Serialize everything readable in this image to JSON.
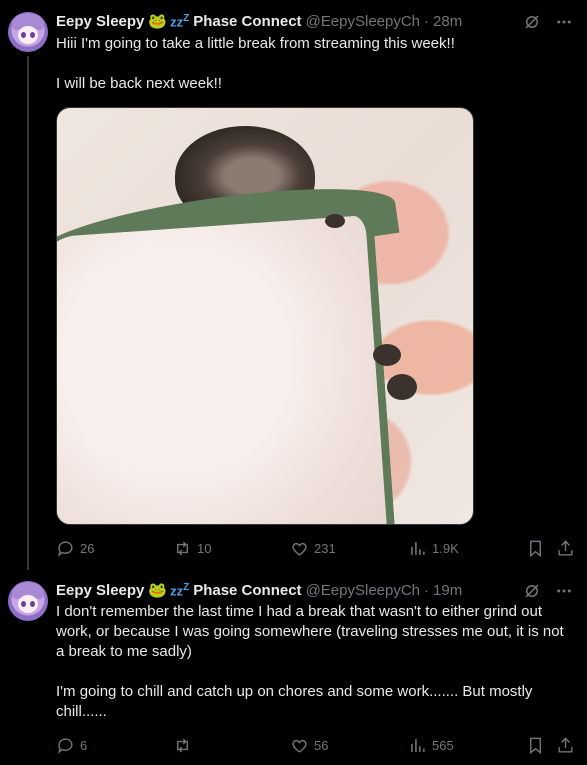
{
  "tweets": [
    {
      "author": {
        "name": "Eepy Sleepy",
        "emoji": "🐸",
        "zz": "zz",
        "zz_sup": "Z",
        "org": "Phase Connect",
        "handle": "@EepySleepyCh"
      },
      "time": "28m",
      "text": "Hiii I'm going to take a little break from streaming this week!!\n\nI will be back next week!!",
      "has_media": true,
      "stats": {
        "replies": "26",
        "reposts": "10",
        "likes": "231",
        "views": "1.9K"
      }
    },
    {
      "author": {
        "name": "Eepy Sleepy",
        "emoji": "🐸",
        "zz": "zz",
        "zz_sup": "Z",
        "org": "Phase Connect",
        "handle": "@EepySleepyCh"
      },
      "time": "19m",
      "text": "I don't remember the last time I had a break that wasn't to either grind out work, or because I was going somewhere (traveling stresses me out, it is not a break to me sadly)\n\nI'm going to chill and catch up on chores and some work....... But mostly chill......",
      "has_media": false,
      "stats": {
        "replies": "6",
        "reposts": "",
        "likes": "56",
        "views": "565"
      }
    }
  ],
  "colors": {
    "background": "#000000",
    "text": "#e7e9ea",
    "muted": "#71767b",
    "thread_line": "#333639"
  },
  "icons": [
    "grok-icon",
    "more-icon",
    "reply-icon",
    "repost-icon",
    "like-icon",
    "views-icon",
    "bookmark-icon",
    "share-icon"
  ]
}
